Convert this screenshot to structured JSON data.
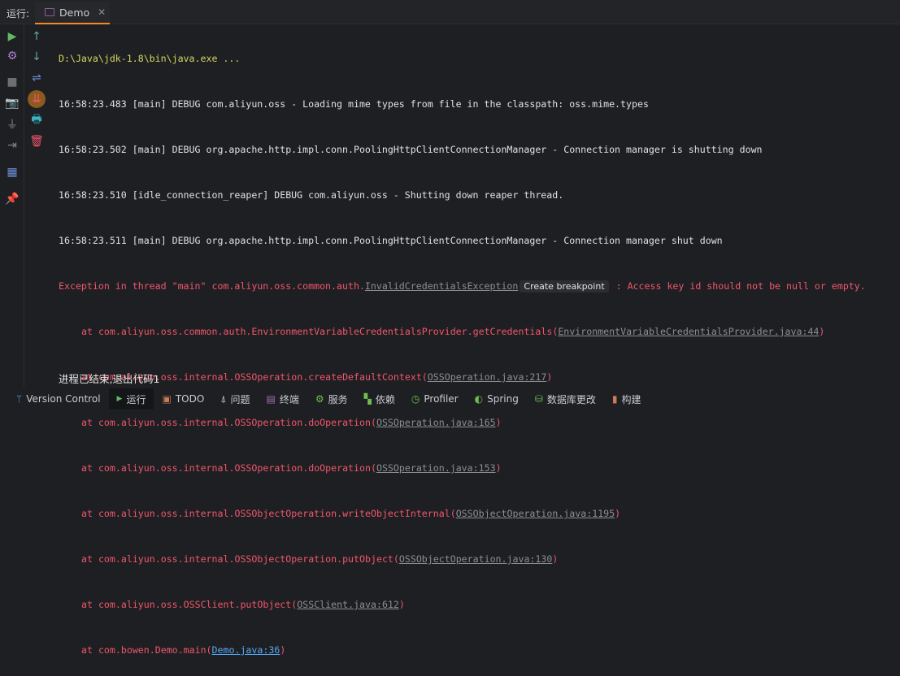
{
  "header": {
    "run_label": "运行:",
    "tab": "Demo"
  },
  "console": {
    "command": "D:\\Java\\jdk-1.8\\bin\\java.exe ...",
    "logs": [
      "16:58:23.483 [main] DEBUG com.aliyun.oss - Loading mime types from file in the classpath: oss.mime.types",
      "16:58:23.502 [main] DEBUG org.apache.http.impl.conn.PoolingHttpClientConnectionManager - Connection manager is shutting down",
      "16:58:23.510 [idle_connection_reaper] DEBUG com.aliyun.oss - Shutting down reaper thread.",
      "16:58:23.511 [main] DEBUG org.apache.http.impl.conn.PoolingHttpClientConnectionManager - Connection manager shut down"
    ],
    "exception": {
      "prefix": "Exception in thread \"main\" com.aliyun.oss.common.auth.",
      "class_link": "InvalidCredentialsException",
      "breakpoint": "Create breakpoint",
      "message": " : Access key id should not be null or empty."
    },
    "stack": [
      {
        "at": "at com.aliyun.oss.common.auth.EnvironmentVariableCredentialsProvider.getCredentials(",
        "link": "EnvironmentVariableCredentialsProvider.java:44"
      },
      {
        "at": "at com.aliyun.oss.internal.OSSOperation.createDefaultContext(",
        "link": "OSSOperation.java:217"
      },
      {
        "at": "at com.aliyun.oss.internal.OSSOperation.doOperation(",
        "link": "OSSOperation.java:165"
      },
      {
        "at": "at com.aliyun.oss.internal.OSSOperation.doOperation(",
        "link": "OSSOperation.java:153"
      },
      {
        "at": "at com.aliyun.oss.internal.OSSObjectOperation.writeObjectInternal(",
        "link": "OSSObjectOperation.java:1195"
      },
      {
        "at": "at com.aliyun.oss.internal.OSSObjectOperation.putObject(",
        "link": "OSSObjectOperation.java:130"
      },
      {
        "at": "at com.aliyun.oss.OSSClient.putObject(",
        "link": "OSSClient.java:612"
      },
      {
        "at": "at com.bowen.Demo.main(",
        "link": "Demo.java:36"
      }
    ],
    "exit": "进程已结束,退出代码1"
  },
  "statusbar": [
    {
      "label": "Version Control",
      "icon": "branch-icon",
      "color": "#4a9fd8"
    },
    {
      "label": "运行",
      "icon": "play-icon",
      "color": "#5fb865"
    },
    {
      "label": "TODO",
      "icon": "todo-icon",
      "color": "#c77b5a"
    },
    {
      "label": "问题",
      "icon": "problems-icon",
      "color": "#c9ccd2"
    },
    {
      "label": "终端",
      "icon": "terminal-icon",
      "color": "#a36fb0"
    },
    {
      "label": "服务",
      "icon": "services-icon",
      "color": "#6fbf4f"
    },
    {
      "label": "依赖",
      "icon": "dependencies-icon",
      "color": "#6fbf4f"
    },
    {
      "label": "Profiler",
      "icon": "profiler-icon",
      "color": "#6fbf4f"
    },
    {
      "label": "Spring",
      "icon": "spring-icon",
      "color": "#6fbf4f"
    },
    {
      "label": "数据库更改",
      "icon": "database-icon",
      "color": "#6fbf4f"
    },
    {
      "label": "构建",
      "icon": "build-icon",
      "color": "#c77b5a"
    }
  ]
}
